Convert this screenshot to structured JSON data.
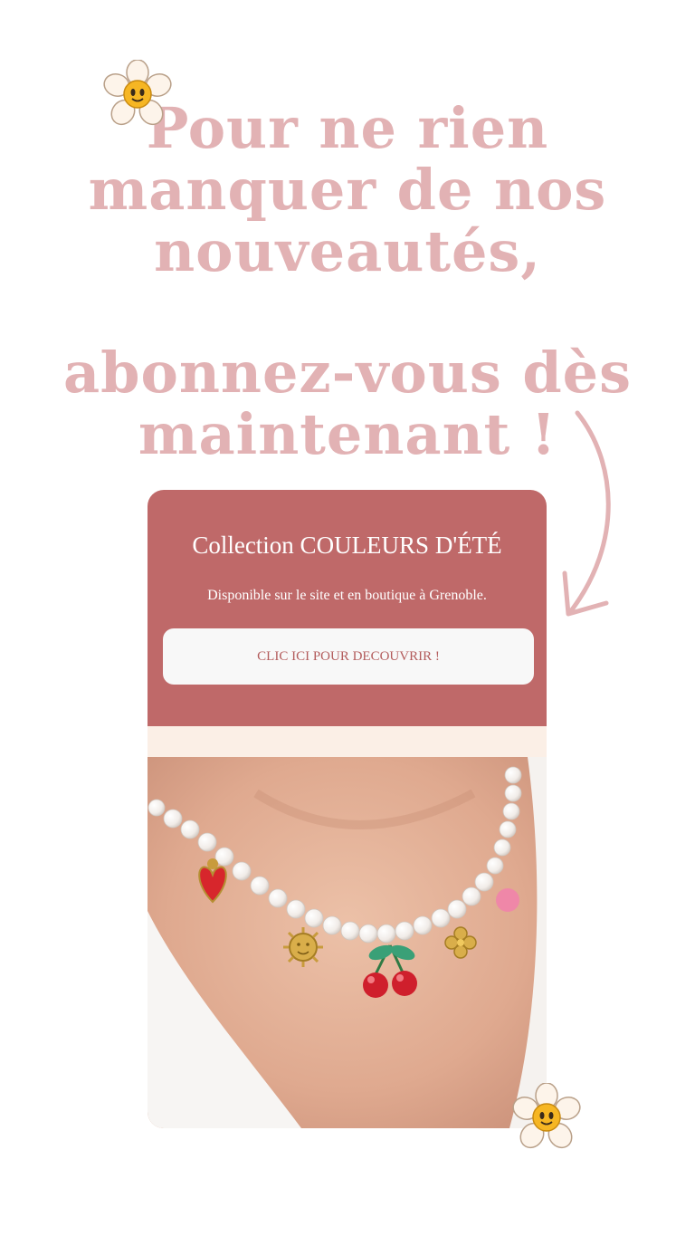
{
  "headline": {
    "line1": "Pour ne rien manquer de nos nouveautés,",
    "line2": "abonnez-vous dès maintenant !"
  },
  "promo": {
    "title": "Collection COULEURS D'ÉTÉ",
    "subtitle": "Disponible sur le site et en boutique à Grenoble.",
    "cta_label": "CLIC ICI POUR DECOUVRIR !"
  },
  "colors": {
    "headline": "#e2b2b4",
    "promo_background": "#bf6969",
    "cta_background": "#f8f8f8",
    "cta_text": "#b35c5c",
    "cream": "#fbefe6"
  },
  "icons": [
    "daisy-icon",
    "curved-arrow-icon"
  ],
  "image": {
    "subject": "pearl-necklace-photo"
  }
}
